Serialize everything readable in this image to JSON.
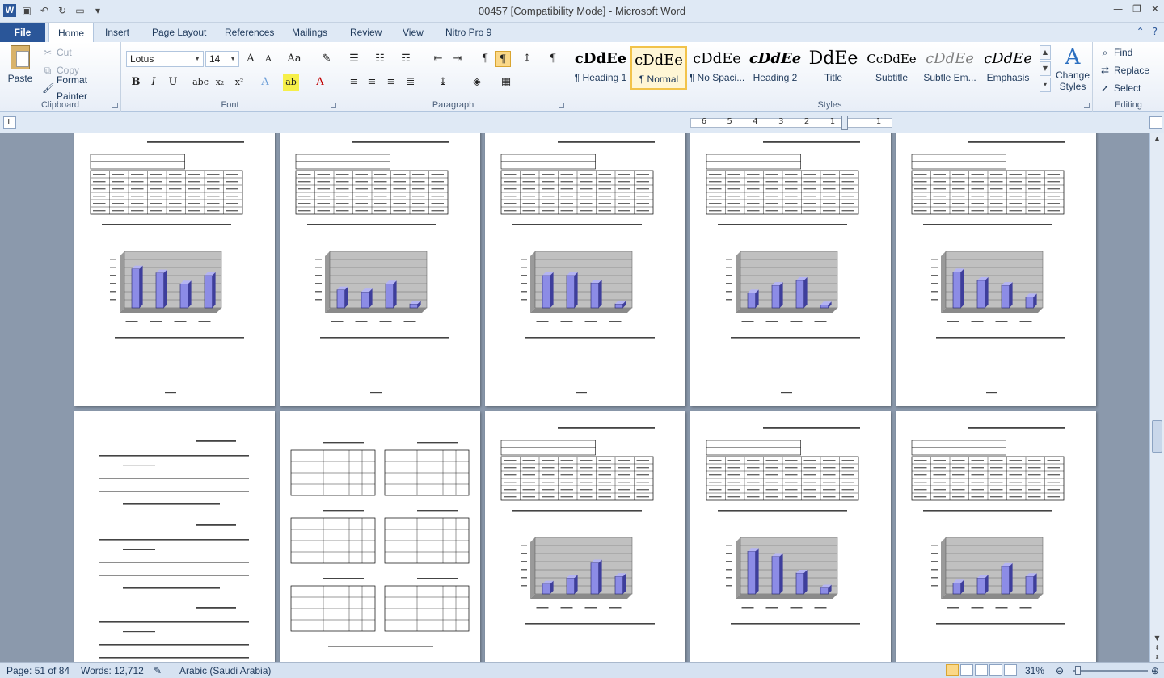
{
  "app": {
    "title": "00457 [Compatibility Mode]  -  Microsoft Word",
    "icon": "word-icon"
  },
  "quick_access": [
    "save-icon",
    "undo-icon",
    "redo-icon",
    "new-document-icon",
    "customize-icon"
  ],
  "tabs": [
    {
      "label": "File"
    },
    {
      "label": "Home"
    },
    {
      "label": "Insert"
    },
    {
      "label": "Page Layout"
    },
    {
      "label": "References"
    },
    {
      "label": "Mailings"
    },
    {
      "label": "Review"
    },
    {
      "label": "View"
    },
    {
      "label": "Nitro Pro 9"
    }
  ],
  "ribbon": {
    "clipboard": {
      "group_label": "Clipboard",
      "paste": "Paste",
      "cut": "Cut",
      "copy": "Copy",
      "format_painter": "Format Painter"
    },
    "font": {
      "group_label": "Font",
      "font_name": "Lotus",
      "font_size": "14",
      "buttons": [
        "B",
        "I",
        "U",
        "abc",
        "x₂",
        "x²",
        "Aa",
        "A",
        "ab",
        "A"
      ]
    },
    "paragraph": {
      "group_label": "Paragraph"
    },
    "styles": {
      "group_label": "Styles",
      "items": [
        {
          "preview": "cDdEe",
          "name": "¶ Heading 1"
        },
        {
          "preview": "cDdEe",
          "name": "¶ Normal"
        },
        {
          "preview": "cDdEe",
          "name": "¶ No Spaci..."
        },
        {
          "preview": "cDdEe",
          "name": "Heading 2"
        },
        {
          "preview": "DdEe",
          "name": "Title"
        },
        {
          "preview": "CcDdEe",
          "name": "Subtitle"
        },
        {
          "preview": "cDdEe",
          "name": "Subtle Em..."
        },
        {
          "preview": "cDdEe",
          "name": "Emphasis"
        }
      ],
      "change_styles": "Change Styles"
    },
    "editing": {
      "group_label": "Editing",
      "find": "Find",
      "replace": "Replace",
      "select": "Select"
    }
  },
  "ruler": {
    "numbers": [
      "6",
      "5",
      "4",
      "3",
      "2",
      "1",
      "",
      "1"
    ]
  },
  "status": {
    "page": "Page: 51 of 84",
    "words": "Words: 12,712",
    "language": "Arabic (Saudi Arabia)",
    "zoom": "31%"
  },
  "pages_row1": [
    {
      "bars": [
        0.78,
        0.7,
        0.48,
        0.65
      ],
      "ymax": 100
    },
    {
      "bars": [
        0.36,
        0.32,
        0.48,
        0.08
      ],
      "ymax": 100
    },
    {
      "bars": [
        0.65,
        0.65,
        0.5,
        0.08
      ],
      "ymax": 100
    },
    {
      "bars": [
        0.3,
        0.45,
        0.55,
        0.06
      ],
      "ymax": 100
    },
    {
      "bars": [
        0.72,
        0.55,
        0.45,
        0.22
      ],
      "ymax": 100
    }
  ],
  "pages_row2": [
    {
      "bars": [
        0.2,
        0.32,
        0.62,
        0.35
      ],
      "ymax": 100
    },
    {
      "bars": [
        0.85,
        0.75,
        0.42,
        0.12
      ],
      "ymax": 100
    },
    {
      "bars": [
        0.22,
        0.32,
        0.55,
        0.35
      ],
      "ymax": 100
    }
  ]
}
